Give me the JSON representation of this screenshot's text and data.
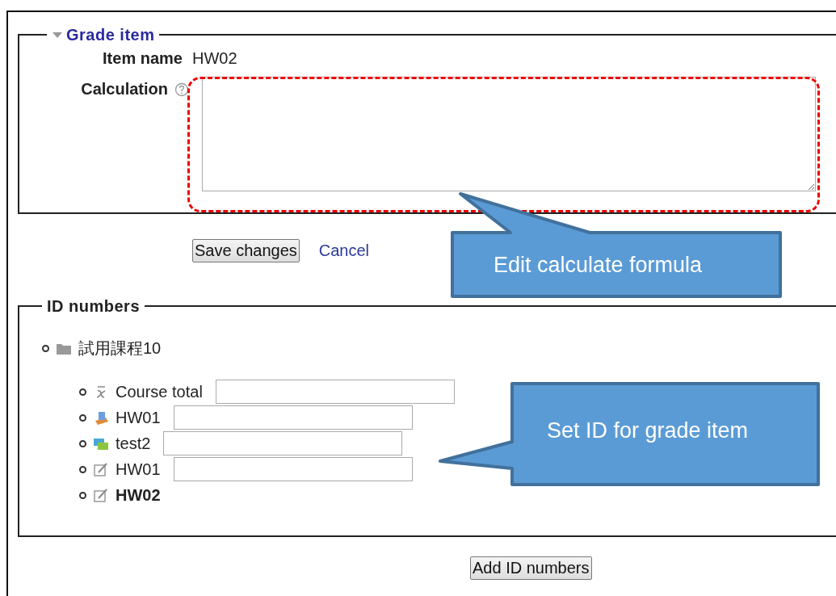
{
  "grade_item": {
    "legend": "Grade item",
    "expanded": true,
    "item_name_label": "Item name",
    "item_name": "HW02",
    "calculation_label": "Calculation"
  },
  "buttons": {
    "save": "Save changes",
    "cancel": "Cancel"
  },
  "id_numbers": {
    "legend": "ID numbers",
    "tree": [
      {
        "label": "試用課程10",
        "kind": "category",
        "children": [
          {
            "label": "Course total",
            "kind": "total",
            "editable": true
          },
          {
            "label": "HW01",
            "kind": "assignment",
            "editable": true
          },
          {
            "label": "test2",
            "kind": "forum",
            "editable": true
          },
          {
            "label": "HW01",
            "kind": "manual",
            "editable": true
          },
          {
            "label": "HW02",
            "kind": "manual",
            "editable": false
          }
        ]
      }
    ]
  },
  "add_button": "Add ID numbers",
  "callouts": [
    {
      "text": "Edit calculate formula"
    },
    {
      "text": "Set ID for grade item"
    }
  ]
}
